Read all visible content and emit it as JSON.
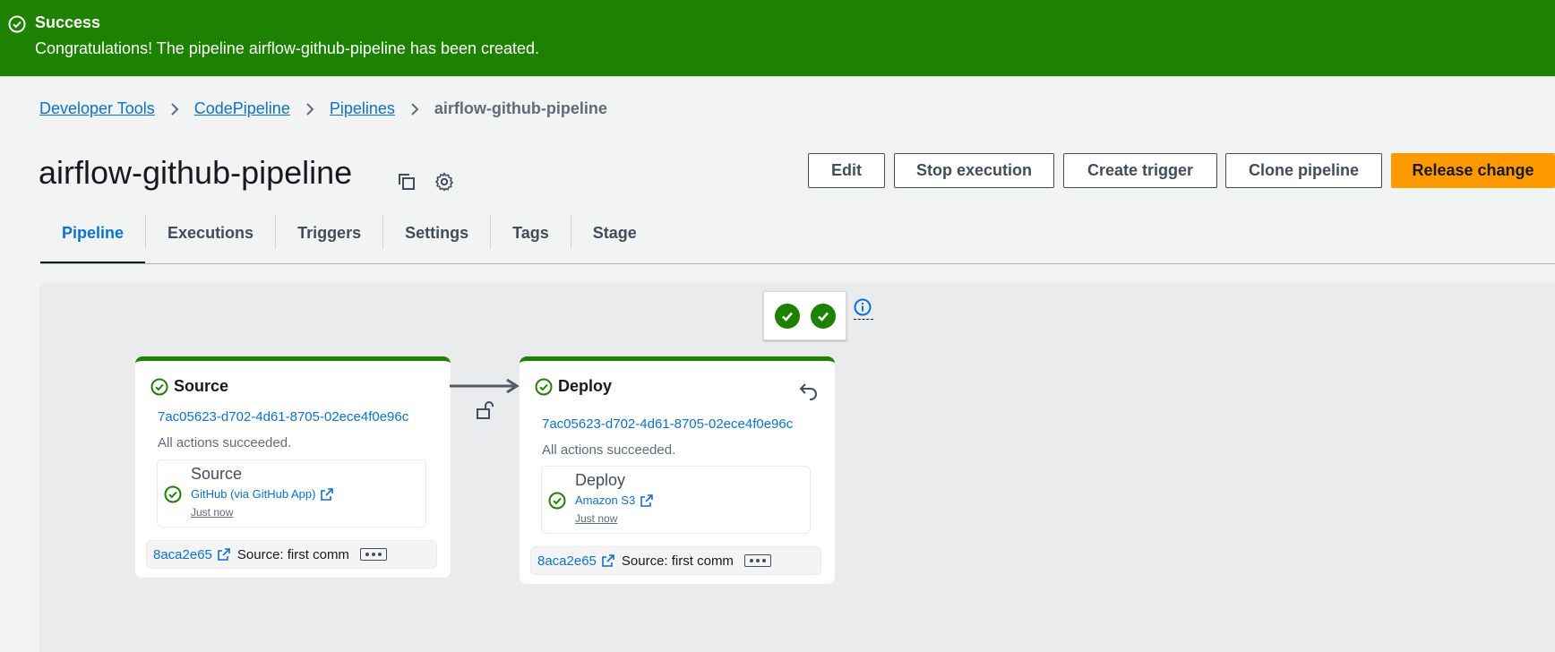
{
  "flash": {
    "type": "success",
    "header": "Success",
    "message": "Congratulations! The pipeline airflow-github-pipeline has been created."
  },
  "breadcrumb": {
    "items": [
      "Developer Tools",
      "CodePipeline",
      "Pipelines"
    ],
    "current": "airflow-github-pipeline"
  },
  "page": {
    "title": "airflow-github-pipeline"
  },
  "actions": {
    "edit": "Edit",
    "stop": "Stop execution",
    "trigger": "Create trigger",
    "clone": "Clone pipeline",
    "release": "Release change"
  },
  "tabs": [
    "Pipeline",
    "Executions",
    "Triggers",
    "Settings",
    "Tags",
    "Stage"
  ],
  "active_tab": "Pipeline",
  "stages": [
    {
      "name": "Source",
      "execution_id": "7ac05623-d702-4d61-8705-02ece4f0e96c",
      "status": "All actions succeeded.",
      "action": {
        "name": "Source",
        "provider": "GitHub (via GitHub App)",
        "time": "Just now"
      },
      "commit_id": "8aca2e65",
      "commit_message": "Source: first comm"
    },
    {
      "name": "Deploy",
      "execution_id": "7ac05623-d702-4d61-8705-02ece4f0e96c",
      "status": "All actions succeeded.",
      "action": {
        "name": "Deploy",
        "provider": "Amazon S3",
        "time": "Just now"
      },
      "commit_id": "8aca2e65",
      "commit_message": "Source: first comm"
    }
  ],
  "colors": {
    "success": "#1d8102",
    "link": "#0972d3",
    "primary_button": "#ff9900"
  }
}
